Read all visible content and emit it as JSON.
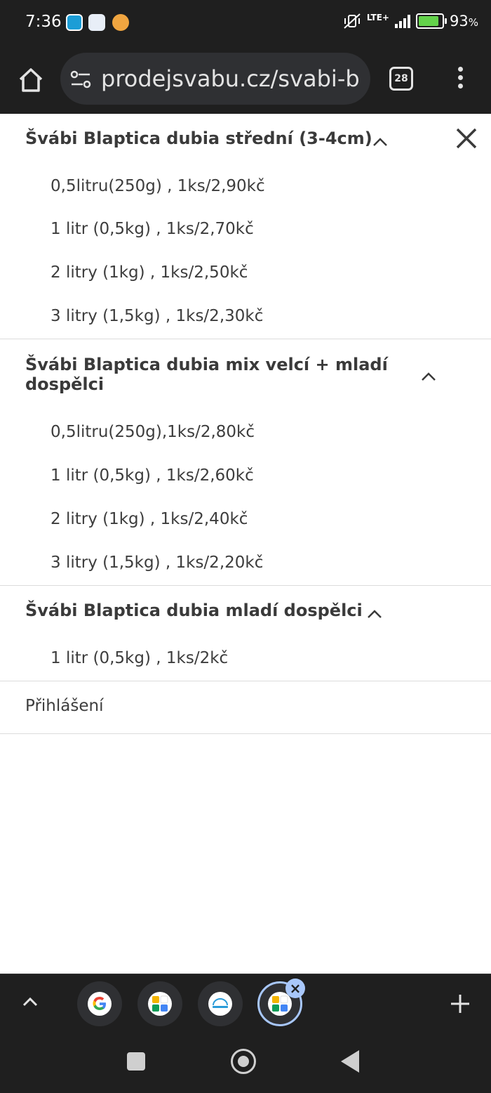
{
  "status_bar": {
    "time": "7:36",
    "network": "LTE+",
    "battery_percent": "93",
    "battery_unit": "%",
    "battery_level": 0.93,
    "notification_icons": [
      "messenger-icon",
      "calendar-app-icon",
      "compass-app-icon"
    ]
  },
  "browser": {
    "url": "prodejsvabu.cz/svabi-bl",
    "tab_count": "28"
  },
  "menu": {
    "categories": [
      {
        "title": "Švábi Blaptica dubia střední (3-4cm)",
        "items": [
          "0,5litru(250g) , 1ks/2,90kč",
          "1 litr (0,5kg) , 1ks/2,70kč",
          "2 litry (1kg) , 1ks/2,50kč",
          "3 litry (1,5kg) , 1ks/2,30kč"
        ]
      },
      {
        "title_line1": "Švábi Blaptica dubia mix velcí + mladí",
        "title_line2": "dospělci",
        "items": [
          "0,5litru(250g),1ks/2,80kč",
          "1 litr (0,5kg) , 1ks/2,60kč",
          "2 litry (1kg) , 1ks/2,40kč",
          "3 litry (1,5kg) , 1ks/2,20kč"
        ]
      },
      {
        "title": "Švábi Blaptica dubia mladí dospělci",
        "items": [
          "1 litr (0,5kg) , 1ks/2kč"
        ]
      }
    ],
    "login_label": "Přihlášení"
  },
  "tab_group": {
    "tabs": [
      "google-icon",
      "multicolor-app-icon",
      "store-logo-icon",
      "multicolor-app-icon"
    ],
    "active_index": 3
  },
  "colors": {
    "chrome_dark": "#1f1f1f",
    "omnibox": "#2f3033",
    "accent": "#a8c7fa",
    "text": "#3d3d3d"
  }
}
